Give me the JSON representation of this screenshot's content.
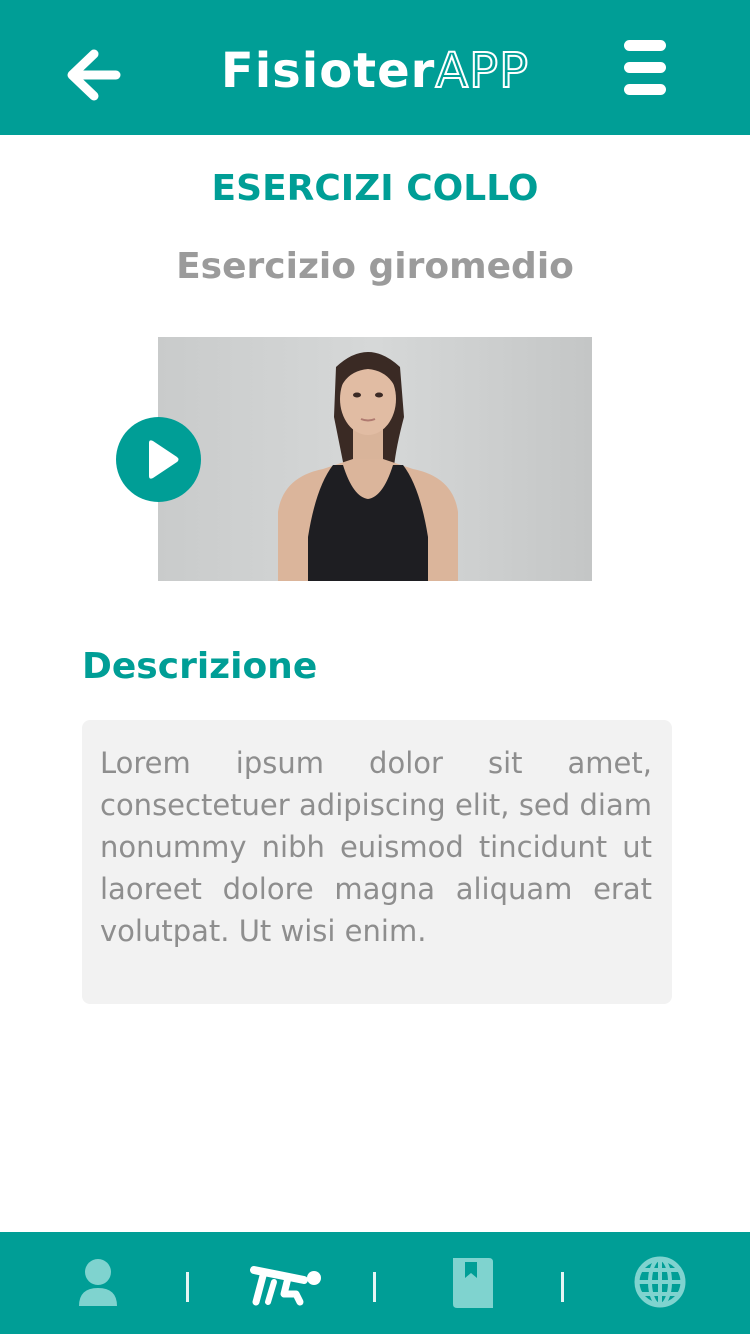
{
  "theme": {
    "accent": "#009e96",
    "accent_light": "#7fd3cf"
  },
  "header": {
    "title_part1": "Fisioter",
    "title_part2": "APP",
    "back_icon": "arrow-left-icon",
    "menu_icon": "hamburger-menu-icon"
  },
  "content": {
    "section_title": "ESERCIZI COLLO",
    "exercise_name": "Esercizio giromedio",
    "video": {
      "play_icon": "play-icon"
    },
    "description_heading": "Descrizione",
    "description_text": "Lorem ipsum dolor sit amet, consectetuer adipiscing elit, sed diam nonummy nibh euismod tincidunt ut laoreet dolore magna aliquam erat volutpat. Ut wisi enim."
  },
  "bottom_nav": {
    "items": [
      {
        "icon": "user-icon",
        "active": false
      },
      {
        "icon": "exercise-icon",
        "active": true
      },
      {
        "icon": "bookmark-book-icon",
        "active": false
      },
      {
        "icon": "globe-icon",
        "active": false
      }
    ]
  }
}
